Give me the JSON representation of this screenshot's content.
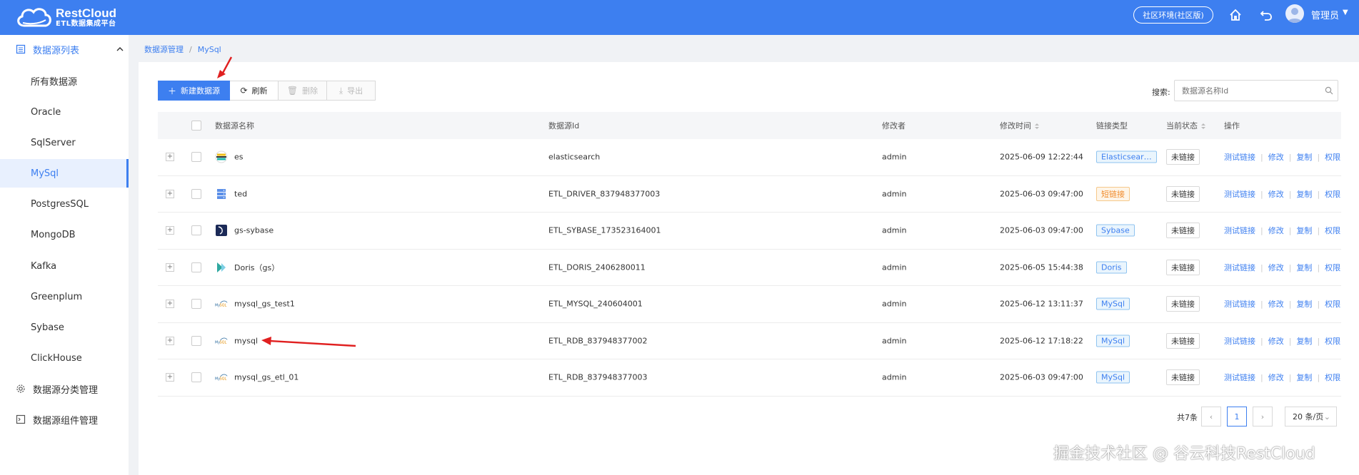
{
  "header": {
    "brand": "RestCloud",
    "brand_sub": "ETL数据集成平台",
    "env_button": "社区环境(社区版)",
    "user_name": "管理员"
  },
  "sidebar": {
    "group_list": "数据源列表",
    "items": [
      {
        "label": "所有数据源",
        "active": false
      },
      {
        "label": "Oracle",
        "active": false
      },
      {
        "label": "SqlServer",
        "active": false
      },
      {
        "label": "MySql",
        "active": true
      },
      {
        "label": "PostgresSQL",
        "active": false
      },
      {
        "label": "MongoDB",
        "active": false
      },
      {
        "label": "Kafka",
        "active": false
      },
      {
        "label": "Greenplum",
        "active": false
      },
      {
        "label": "Sybase",
        "active": false
      },
      {
        "label": "ClickHouse",
        "active": false
      }
    ],
    "group_category": "数据源分类管理",
    "group_component": "数据源组件管理"
  },
  "breadcrumb": {
    "root": "数据源管理",
    "sep": "/",
    "current": "MySql"
  },
  "toolbar": {
    "new": "新建数据源",
    "refresh": "刷新",
    "delete": "删除",
    "export": "导出"
  },
  "search": {
    "label": "搜索:",
    "placeholder": "数据源名称Id"
  },
  "table": {
    "headers": {
      "name": "数据源名称",
      "id": "数据源Id",
      "modifier": "修改者",
      "mtime": "修改时间",
      "type": "链接类型",
      "status": "当前状态",
      "ops": "操作"
    },
    "rows": [
      {
        "name": "es",
        "id": "elasticsearch",
        "modifier": "admin",
        "mtime": "2025-06-09 12:22:44",
        "type": "Elasticsear…",
        "type_color": "blue",
        "status": "未链接",
        "icon": "elasticsearch-icon"
      },
      {
        "name": "ted",
        "id": "ETL_DRIVER_837948377003",
        "modifier": "admin",
        "mtime": "2025-06-03 09:47:00",
        "type": "短链接",
        "type_color": "orange",
        "status": "未链接",
        "icon": "database-server-icon"
      },
      {
        "name": "gs-sybase",
        "id": "ETL_SYBASE_173523164001",
        "modifier": "admin",
        "mtime": "2025-06-03 09:47:00",
        "type": "Sybase",
        "type_color": "blue",
        "status": "未链接",
        "icon": "sybase-icon"
      },
      {
        "name": "Doris（gs）",
        "id": "ETL_DORIS_2406280011",
        "modifier": "admin",
        "mtime": "2025-06-05 15:44:38",
        "type": "Doris",
        "type_color": "blue",
        "status": "未链接",
        "icon": "doris-icon"
      },
      {
        "name": "mysql_gs_test1",
        "id": "ETL_MYSQL_240604001",
        "modifier": "admin",
        "mtime": "2025-06-12 13:11:37",
        "type": "MySql",
        "type_color": "blue",
        "status": "未链接",
        "icon": "mysql-icon"
      },
      {
        "name": "mysql",
        "id": "ETL_RDB_837948377002",
        "modifier": "admin",
        "mtime": "2025-06-12 17:18:22",
        "type": "MySql",
        "type_color": "blue",
        "status": "未链接",
        "icon": "mysql-icon"
      },
      {
        "name": "mysql_gs_etl_01",
        "id": "ETL_RDB_837948377003",
        "modifier": "admin",
        "mtime": "2025-06-03 09:47:00",
        "type": "MySql",
        "type_color": "blue",
        "status": "未链接",
        "icon": "mysql-icon"
      }
    ],
    "ops": {
      "test": "测试链接",
      "edit": "修改",
      "copy": "复制",
      "perm": "权限"
    }
  },
  "pager": {
    "total": "共7条",
    "current": "1",
    "page_size": "20 条/页"
  },
  "watermark": "掘金技术社区 @ 谷云科技RestCloud",
  "colors": {
    "primary": "#3d7ff0",
    "tag_orange": "#f08c2e",
    "annotation_red": "#e02020"
  }
}
